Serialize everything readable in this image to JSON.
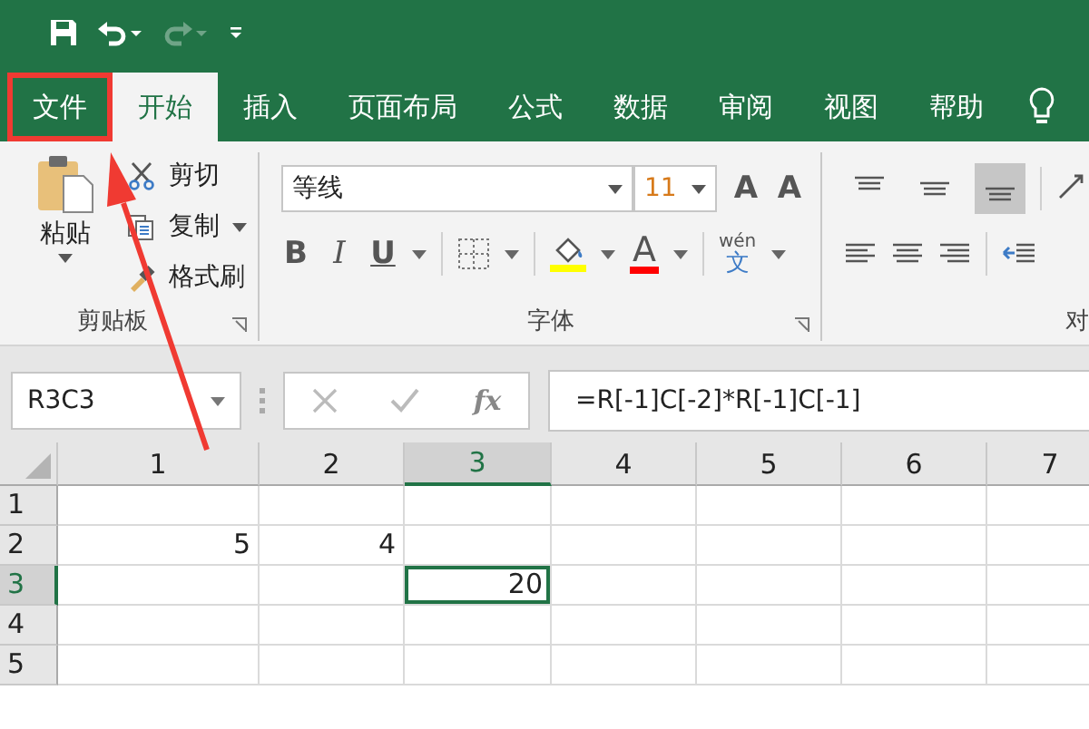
{
  "quick_access": {
    "undo_enabled": true,
    "redo_enabled": false
  },
  "tabs": [
    {
      "label": "文件",
      "selected": false,
      "annotated": true
    },
    {
      "label": "开始",
      "selected": true,
      "annotated": false
    },
    {
      "label": "插入",
      "selected": false,
      "annotated": false
    },
    {
      "label": "页面布局",
      "selected": false,
      "annotated": false
    },
    {
      "label": "公式",
      "selected": false,
      "annotated": false
    },
    {
      "label": "数据",
      "selected": false,
      "annotated": false
    },
    {
      "label": "审阅",
      "selected": false,
      "annotated": false
    },
    {
      "label": "视图",
      "selected": false,
      "annotated": false
    },
    {
      "label": "帮助",
      "selected": false,
      "annotated": false
    }
  ],
  "clipboard": {
    "paste": "粘贴",
    "cut": "剪切",
    "copy": "复制",
    "format_painter": "格式刷",
    "label": "剪贴板"
  },
  "font": {
    "name": "等线",
    "size": "11",
    "grow": "A",
    "shrink": "A",
    "bold": "B",
    "italic": "I",
    "underline": "U",
    "color_letter": "A",
    "phonetic_top": "wén",
    "phonetic_char": "文",
    "label": "字体"
  },
  "alignment": {
    "label": "对",
    "vertical": [
      {
        "kind": "top",
        "selected": false
      },
      {
        "kind": "middle",
        "selected": false
      },
      {
        "kind": "bottom",
        "selected": true
      }
    ]
  },
  "formula_bar": {
    "name_box": "R3C3",
    "fx": "fx",
    "formula": "=R[-1]C[-2]*R[-1]C[-1]"
  },
  "sheet": {
    "columns": [
      {
        "label": "1",
        "selected": false
      },
      {
        "label": "2",
        "selected": false
      },
      {
        "label": "3",
        "selected": true
      },
      {
        "label": "4",
        "selected": false
      },
      {
        "label": "5",
        "selected": false
      },
      {
        "label": "6",
        "selected": false
      },
      {
        "label": "7",
        "selected": false
      }
    ],
    "rows": [
      {
        "label": "1",
        "selected": false,
        "cells": [
          {
            "active": false
          },
          {
            "active": false
          },
          {
            "active": false
          },
          {
            "active": false
          },
          {
            "active": false
          },
          {
            "active": false
          },
          {
            "active": false
          }
        ]
      },
      {
        "label": "2",
        "selected": false,
        "cells": [
          {
            "value": "5",
            "active": false
          },
          {
            "value": "4",
            "active": false
          },
          {
            "active": false
          },
          {
            "active": false
          },
          {
            "active": false
          },
          {
            "active": false
          },
          {
            "active": false
          }
        ]
      },
      {
        "label": "3",
        "selected": true,
        "cells": [
          {
            "active": false
          },
          {
            "active": false
          },
          {
            "value": "20",
            "active": true
          },
          {
            "active": false
          },
          {
            "active": false
          },
          {
            "active": false
          },
          {
            "active": false
          }
        ]
      },
      {
        "label": "4",
        "selected": false,
        "cells": [
          {
            "active": false
          },
          {
            "active": false
          },
          {
            "active": false
          },
          {
            "active": false
          },
          {
            "active": false
          },
          {
            "active": false
          },
          {
            "active": false
          }
        ]
      },
      {
        "label": "5",
        "selected": false,
        "cells": [
          {
            "active": false
          },
          {
            "active": false
          },
          {
            "active": false
          },
          {
            "active": false
          },
          {
            "active": false
          },
          {
            "active": false
          },
          {
            "active": false
          }
        ]
      }
    ]
  }
}
